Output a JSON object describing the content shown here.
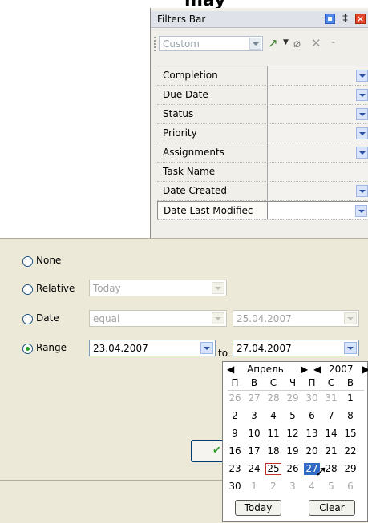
{
  "top_fragment": "may",
  "panel": {
    "title": "Filters Bar",
    "profile_combo": "Custom",
    "rows": [
      {
        "label": "Completion",
        "dropdown": true
      },
      {
        "label": "Due Date",
        "dropdown": true
      },
      {
        "label": "Status",
        "dropdown": true
      },
      {
        "label": "Priority",
        "dropdown": true
      },
      {
        "label": "Assignments",
        "dropdown": true
      },
      {
        "label": "Task Name",
        "dropdown": false
      },
      {
        "label": "Date Created",
        "dropdown": true
      },
      {
        "label": "Date Last Modifiec",
        "dropdown": true
      }
    ]
  },
  "date_filter": {
    "options": [
      {
        "label": "None",
        "selected": false
      },
      {
        "label": "Relative",
        "selected": false,
        "value": "Today"
      },
      {
        "label": "Date",
        "selected": false,
        "operator": "equal",
        "value": "25.04.2007"
      },
      {
        "label": "Range",
        "selected": true,
        "from": "23.04.2007",
        "to": "27.04.2007"
      }
    ],
    "to_label": "to",
    "ok_icon": "check-icon"
  },
  "calendar": {
    "month": "Апрель",
    "year": "2007",
    "weekdays": [
      "П",
      "В",
      "С",
      "Ч",
      "П",
      "С",
      "В"
    ],
    "weeks": [
      [
        {
          "d": "26",
          "o": true
        },
        {
          "d": "27",
          "o": true
        },
        {
          "d": "28",
          "o": true
        },
        {
          "d": "29",
          "o": true
        },
        {
          "d": "30",
          "o": true
        },
        {
          "d": "31",
          "o": true
        },
        {
          "d": "1",
          "o": false
        }
      ],
      [
        {
          "d": "2"
        },
        {
          "d": "3"
        },
        {
          "d": "4"
        },
        {
          "d": "5"
        },
        {
          "d": "6"
        },
        {
          "d": "7"
        },
        {
          "d": "8"
        }
      ],
      [
        {
          "d": "9"
        },
        {
          "d": "10"
        },
        {
          "d": "11"
        },
        {
          "d": "12"
        },
        {
          "d": "13"
        },
        {
          "d": "14"
        },
        {
          "d": "15"
        }
      ],
      [
        {
          "d": "16"
        },
        {
          "d": "17"
        },
        {
          "d": "18"
        },
        {
          "d": "19"
        },
        {
          "d": "20"
        },
        {
          "d": "21"
        },
        {
          "d": "22"
        }
      ],
      [
        {
          "d": "23"
        },
        {
          "d": "24"
        },
        {
          "d": "25",
          "today": true
        },
        {
          "d": "26"
        },
        {
          "d": "27",
          "selected": true
        },
        {
          "d": "28"
        },
        {
          "d": "29"
        }
      ],
      [
        {
          "d": "30"
        },
        {
          "d": "1",
          "o": true
        },
        {
          "d": "2",
          "o": true
        },
        {
          "d": "3",
          "o": true
        },
        {
          "d": "4",
          "o": true
        },
        {
          "d": "5",
          "o": true
        },
        {
          "d": "6",
          "o": true
        }
      ]
    ],
    "today_label": "Today",
    "clear_label": "Clear"
  }
}
